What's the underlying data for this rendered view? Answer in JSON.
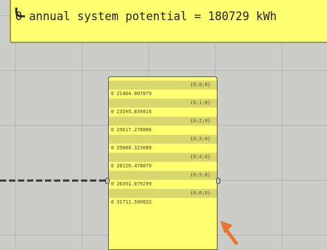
{
  "panel": {
    "text": "0 annual system potential = 180729 kWh"
  },
  "list": {
    "rows": [
      {
        "path": "{0;0;0}",
        "index": "0",
        "value": "21404.007879"
      },
      {
        "path": "{0;1;0}",
        "index": "0",
        "value": "23595.839816"
      },
      {
        "path": "{0;2;0}",
        "index": "0",
        "value": "25617.278886"
      },
      {
        "path": "{0;3;0}",
        "index": "0",
        "value": "25888.323689"
      },
      {
        "path": "{0;4;0}",
        "index": "0",
        "value": "26120.478079"
      },
      {
        "path": "{0;5;0}",
        "index": "0",
        "value": "26391.079299"
      },
      {
        "path": "{0;6;0}",
        "index": "0",
        "value": "31711.590822"
      }
    ]
  },
  "colors": {
    "canvas": "#ccccc9",
    "panel_fill": "#ffff70",
    "path_band": "#d8d86e",
    "arrow": "#e8732a"
  }
}
